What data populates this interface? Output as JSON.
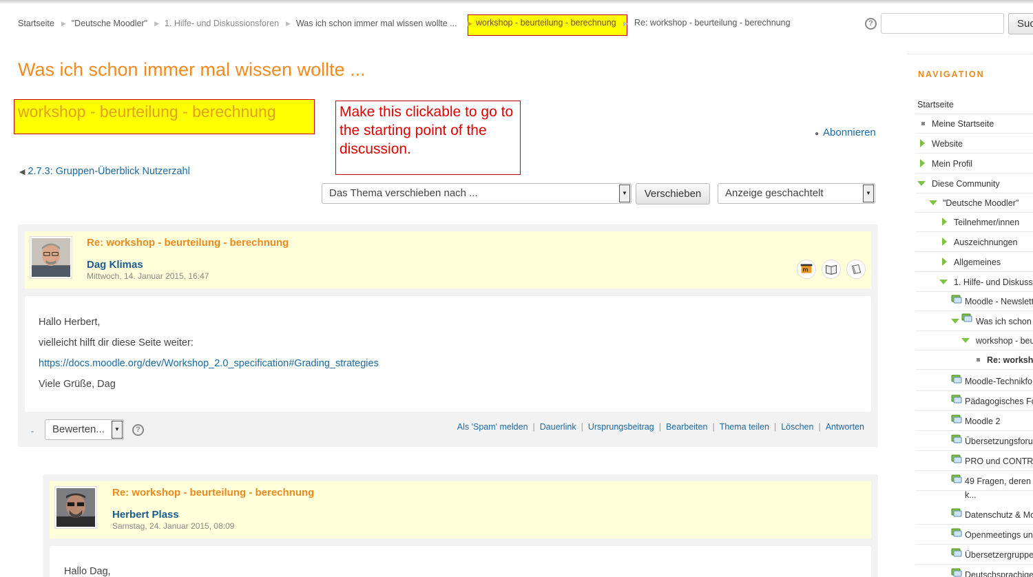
{
  "breadcrumb": {
    "items": [
      "Startseite",
      "\"Deutsche Moodler\"",
      "1. Hilfe- und Diskussionsforen",
      "Was ich schon immer mal wissen wollte ..."
    ],
    "highlighted": "workshop - beurteilung - berechnung",
    "last": "Re: workshop - beurteilung - berechnung"
  },
  "search": {
    "button_label": "Suc",
    "placeholder": ""
  },
  "page": {
    "title": "Was ich schon immer mal wissen wollte ...",
    "discussion_title": "workshop - beurteilung - berechnung",
    "annotation": "Make this clickable to go to the starting point of the discussion.",
    "subscribe_label": "Abonnieren",
    "prev_link": "2.7.3: Gruppen-Überblick Nutzerzahl"
  },
  "controls": {
    "move_select": "Das Thema verschieben nach ...",
    "move_button": "Verschieben",
    "display_select": "Anzeige geschachtelt"
  },
  "posts": [
    {
      "subject": "Re: workshop - beurteilung - berechnung",
      "author": "Dag Klimas",
      "date": "Mittwoch, 14. Januar 2015, 16:47",
      "lines": [
        "Hallo Herbert,",
        "vielleicht hilft dir diese Seite weiter:",
        "https://docs.moodle.org/dev/Workshop_2.0_specification#Grading_strategies",
        "Viele Grüße, Dag"
      ],
      "rate_select": "Bewerten...",
      "dash": "-",
      "commands": [
        "Als 'Spam' melden",
        "Dauerlink",
        "Ursprungsbeitrag",
        "Bearbeiten",
        "Thema teilen",
        "Löschen",
        "Antworten"
      ]
    },
    {
      "subject": "Re: workshop - beurteilung - berechnung",
      "author": "Herbert Plass",
      "date": "Samstag, 24. Januar 2015, 08:09",
      "lines": [
        "Hallo Dag,"
      ]
    }
  ],
  "navigation": {
    "heading": "NAVIGATION",
    "items": [
      "Startseite",
      "Meine Startseite",
      "Website",
      "Mein Profil",
      "Diese Community",
      "\"Deutsche Moodler\"",
      "Teilnehmer/innen",
      "Auszeichnungen",
      "Allgemeines",
      "1. Hilfe- und Diskussi",
      "Moodle - Newslett",
      "Was ich schon",
      "workshop - beu",
      "Re: worksho",
      "Moodle-Technikfo",
      "Pädagogisches Fo",
      "Moodle 2",
      "Übersetzungsforu",
      "PRO und CONTRA",
      "49 Fragen, deren A",
      "k...",
      "Datenschutz & Mo",
      "Openmeetings un",
      "Übersetzergruppe",
      "Deutschsprachige"
    ]
  },
  "colors": {
    "accent": "#ec8a20",
    "link": "#1a6aa6",
    "highlight": "#ffff00",
    "annotation": "#e00000",
    "tree": "#7dc242"
  }
}
